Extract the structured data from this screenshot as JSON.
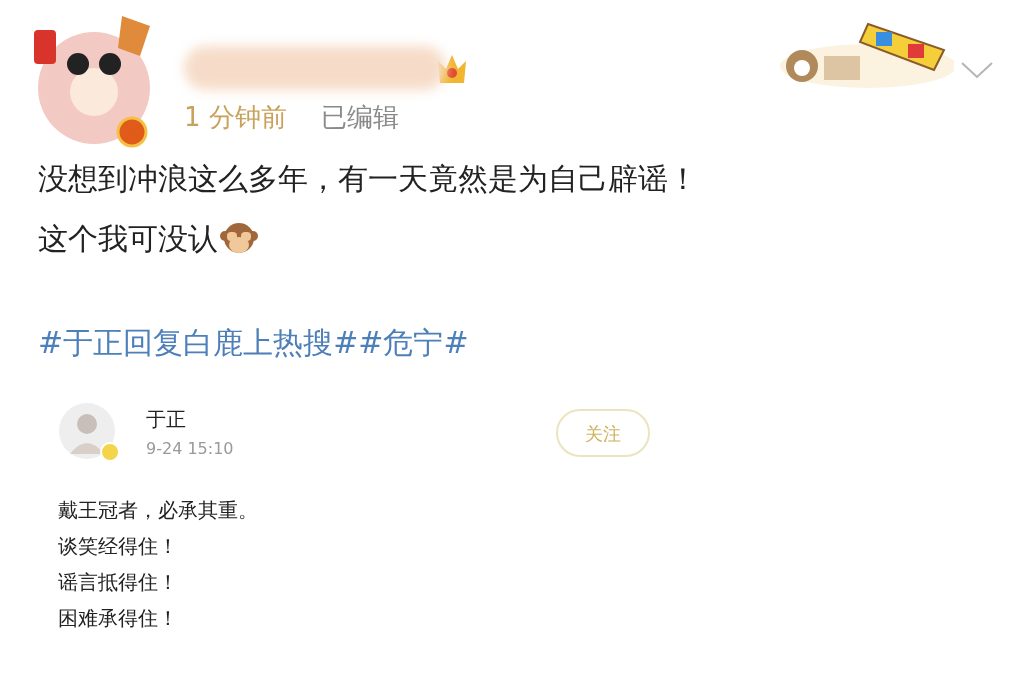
{
  "post": {
    "time": "1 分钟前",
    "edited": "已编辑",
    "text_lines": [
      "没想到冲浪这么多年，有一天竟然是为自己辟谣！",
      "这个我可没认"
    ],
    "hashtags": [
      "#于正回复白鹿上热搜#",
      "#危宁#"
    ]
  },
  "quoted_post": {
    "author": "于正",
    "time": "9-24 15:10",
    "follow_button": "关注",
    "lines": [
      "戴王冠者，必承其重。",
      "谈笑经得住！",
      "谣言抵得住！",
      "困难承得住！"
    ]
  }
}
